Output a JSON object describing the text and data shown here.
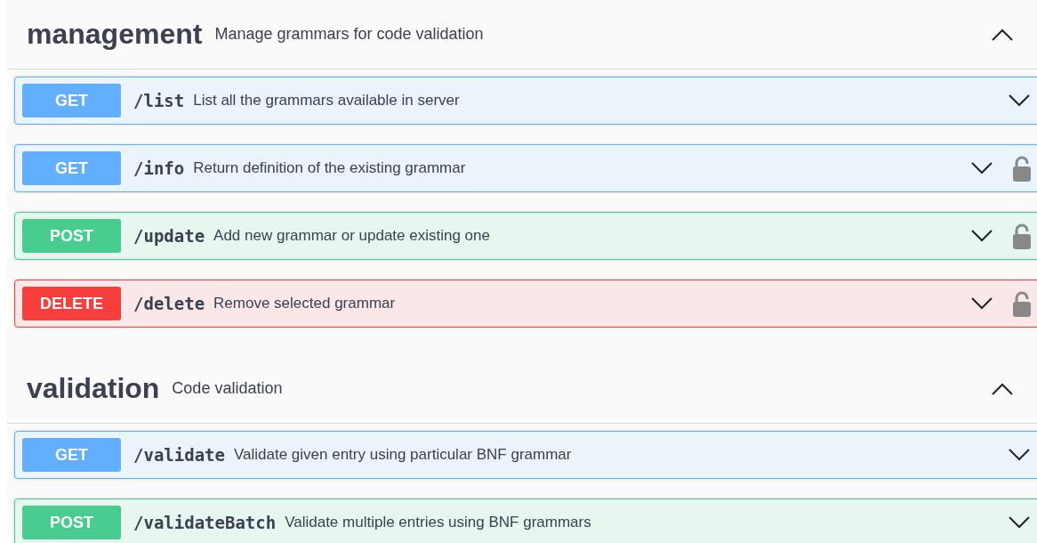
{
  "sections": [
    {
      "name": "management",
      "description": "Manage grammars for code validation",
      "expanded": true,
      "operations": [
        {
          "method": "GET",
          "kind": "get",
          "path": "/list",
          "summary": "List all the grammars available in server",
          "locked": false
        },
        {
          "method": "GET",
          "kind": "get",
          "path": "/info",
          "summary": "Return definition of the existing grammar",
          "locked": true
        },
        {
          "method": "POST",
          "kind": "post",
          "path": "/update",
          "summary": "Add new grammar or update existing one",
          "locked": true
        },
        {
          "method": "DELETE",
          "kind": "delete",
          "path": "/delete",
          "summary": "Remove selected grammar",
          "locked": true
        }
      ]
    },
    {
      "name": "validation",
      "description": "Code validation",
      "expanded": true,
      "operations": [
        {
          "method": "GET",
          "kind": "get",
          "path": "/validate",
          "summary": "Validate given entry using particular BNF grammar",
          "locked": false
        },
        {
          "method": "POST",
          "kind": "post",
          "path": "/validateBatch",
          "summary": "Validate multiple entries using BNF grammars",
          "locked": false
        }
      ]
    }
  ]
}
